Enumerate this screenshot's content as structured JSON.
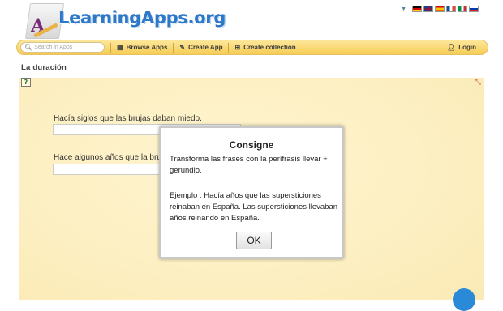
{
  "header": {
    "logo_text": "LearningApps.org",
    "language_flags": [
      "de",
      "gb",
      "es",
      "fr",
      "it",
      "ru"
    ]
  },
  "toolbar": {
    "search_placeholder": "Search in Apps",
    "browse_label": "Browse Apps",
    "create_label": "Create App",
    "collection_label": "Create collection",
    "login_label": "Login"
  },
  "page": {
    "title": "La duración"
  },
  "exercise": {
    "question1": "Hacía siglos que las brujas daban miedo.",
    "question2": "Hace algunos años que la bru",
    "answer1": "",
    "answer2": ""
  },
  "dialog": {
    "title": "Consigne",
    "instruction": "Transforma las frases con la perífrasis llevar + gerundio.",
    "example": "Ejemplo : Hacía años que las supersticiones reinaban en España. Las supersticiones llevaban años reinando en España.",
    "ok_label": "OK"
  },
  "colors": {
    "toolbar": "#f6cd55",
    "logo": "#2e78c8",
    "app_background": "#fdf0c4"
  }
}
